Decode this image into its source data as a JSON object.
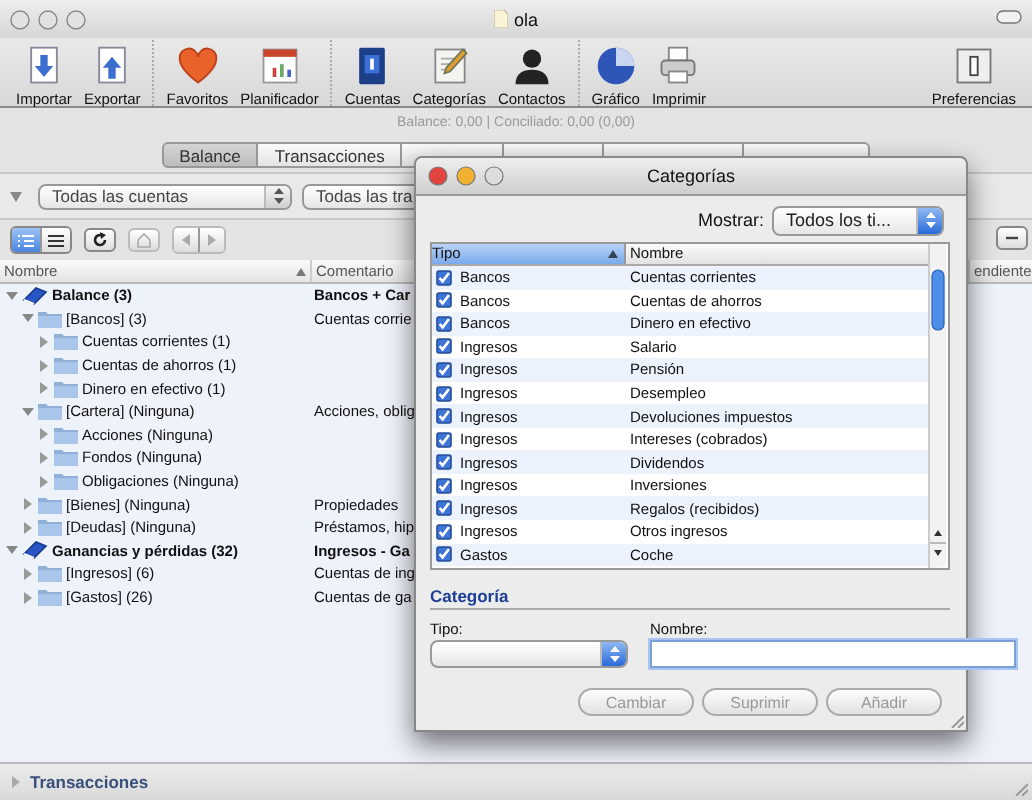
{
  "window": {
    "title": "ola"
  },
  "toolbar": {
    "groups": [
      {
        "items": [
          {
            "kind": "import",
            "label": "Importar"
          },
          {
            "kind": "export",
            "label": "Exportar"
          }
        ]
      },
      {
        "items": [
          {
            "kind": "favorites",
            "label": "Favoritos"
          },
          {
            "kind": "planner",
            "label": "Planificador"
          }
        ]
      },
      {
        "items": [
          {
            "kind": "accounts",
            "label": "Cuentas"
          },
          {
            "kind": "categories",
            "label": "Categorías"
          },
          {
            "kind": "contacts",
            "label": "Contactos"
          }
        ]
      },
      {
        "items": [
          {
            "kind": "chart",
            "label": "Gráfico"
          },
          {
            "kind": "print",
            "label": "Imprimir"
          }
        ]
      }
    ],
    "end_items": [
      {
        "kind": "preferences",
        "label": "Preferencias"
      }
    ]
  },
  "balance_line": "Balance: 0,00 | Conciliado: 0,00 (0,00)",
  "tabs": [
    {
      "label": "Balance",
      "selected": true
    },
    {
      "label": "Transacciones",
      "selected": false
    }
  ],
  "filters": [
    {
      "value": "Todas las cuentas"
    },
    {
      "value": "Todas las tra"
    }
  ],
  "view_modes": [
    {
      "kind": "outline",
      "selected": true
    },
    {
      "kind": "list",
      "selected": false
    }
  ],
  "tree": {
    "columns": [
      "Nombre",
      "Comentario",
      "endiente"
    ],
    "rows": [
      {
        "kind": "book",
        "name": "Balance (3)",
        "comment": "Bancos + Car",
        "expanded": true,
        "children": [
          {
            "kind": "folder",
            "name": "[Bancos] (3)",
            "comment": "Cuentas corrie",
            "expanded": true,
            "children": [
              {
                "kind": "folder",
                "name": "Cuentas corrientes (1)",
                "expanded": false
              },
              {
                "kind": "folder",
                "name": "Cuentas de ahorros (1)",
                "expanded": false
              },
              {
                "kind": "folder",
                "name": "Dinero en efectivo (1)",
                "expanded": false
              }
            ]
          },
          {
            "kind": "folder",
            "name": "[Cartera] (Ninguna)",
            "comment": "Acciones, oblig",
            "expanded": true,
            "children": [
              {
                "kind": "folder",
                "name": "Acciones (Ninguna)",
                "expanded": false
              },
              {
                "kind": "folder",
                "name": "Fondos (Ninguna)",
                "expanded": false
              },
              {
                "kind": "folder",
                "name": "Obligaciones (Ninguna)",
                "expanded": false
              }
            ]
          },
          {
            "kind": "folder",
            "name": "[Bienes] (Ninguna)",
            "comment": "Propiedades",
            "expanded": false
          },
          {
            "kind": "folder",
            "name": "[Deudas] (Ninguna)",
            "comment": "Préstamos, hip",
            "expanded": false
          }
        ]
      },
      {
        "kind": "book",
        "name": "Ganancias y pérdidas (32)",
        "comment": "Ingresos - Ga",
        "expanded": true,
        "children": [
          {
            "kind": "folder",
            "name": "[Ingresos] (6)",
            "comment": "Cuentas de ing",
            "expanded": false
          },
          {
            "kind": "folder",
            "name": "[Gastos] (26)",
            "comment": "Cuentas de ga",
            "expanded": false
          }
        ]
      }
    ]
  },
  "dialog": {
    "title": "Categorías",
    "show_label": "Mostrar:",
    "show_value": "Todos los ti...",
    "columns": [
      "Tipo",
      "Nombre"
    ],
    "rows": [
      {
        "tipo": "Bancos",
        "nombre": "Cuentas corrientes",
        "checked": true
      },
      {
        "tipo": "Bancos",
        "nombre": "Cuentas de ahorros",
        "checked": true
      },
      {
        "tipo": "Bancos",
        "nombre": "Dinero en efectivo",
        "checked": true
      },
      {
        "tipo": "Ingresos",
        "nombre": "Salario",
        "checked": true
      },
      {
        "tipo": "Ingresos",
        "nombre": "Pensión",
        "checked": true
      },
      {
        "tipo": "Ingresos",
        "nombre": "Desempleo",
        "checked": true
      },
      {
        "tipo": "Ingresos",
        "nombre": "Devoluciones impuestos",
        "checked": true
      },
      {
        "tipo": "Ingresos",
        "nombre": "Intereses (cobrados)",
        "checked": true
      },
      {
        "tipo": "Ingresos",
        "nombre": "Dividendos",
        "checked": true
      },
      {
        "tipo": "Ingresos",
        "nombre": "Inversiones",
        "checked": true
      },
      {
        "tipo": "Ingresos",
        "nombre": "Regalos (recibidos)",
        "checked": true
      },
      {
        "tipo": "Ingresos",
        "nombre": "Otros ingresos",
        "checked": true
      },
      {
        "tipo": "Gastos",
        "nombre": "Coche",
        "checked": true
      }
    ],
    "section": "Categoría",
    "type_label": "Tipo:",
    "name_label": "Nombre:",
    "buttons": [
      {
        "label": "Cambiar",
        "disabled": true
      },
      {
        "label": "Suprimir",
        "disabled": true
      },
      {
        "label": "Añadir",
        "disabled": true
      }
    ]
  },
  "bottom_panel": {
    "title": "Transacciones",
    "expanded": false
  }
}
